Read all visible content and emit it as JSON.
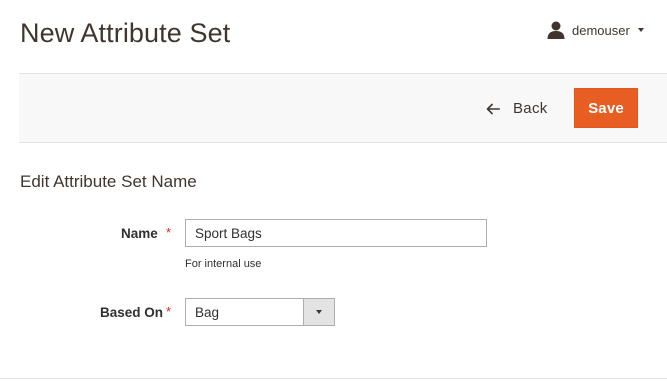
{
  "header": {
    "title": "New Attribute Set",
    "user": {
      "name": "demouser",
      "icon": "user-icon"
    }
  },
  "actions": {
    "back_label": "Back",
    "save_label": "Save",
    "accent_color": "#e85d22"
  },
  "form": {
    "section_title": "Edit Attribute Set Name",
    "required_marker": "*",
    "name_field": {
      "label": "Name",
      "value": "Sport Bags",
      "note": "For internal use"
    },
    "based_on_field": {
      "label": "Based On",
      "selected": "Bag"
    }
  }
}
